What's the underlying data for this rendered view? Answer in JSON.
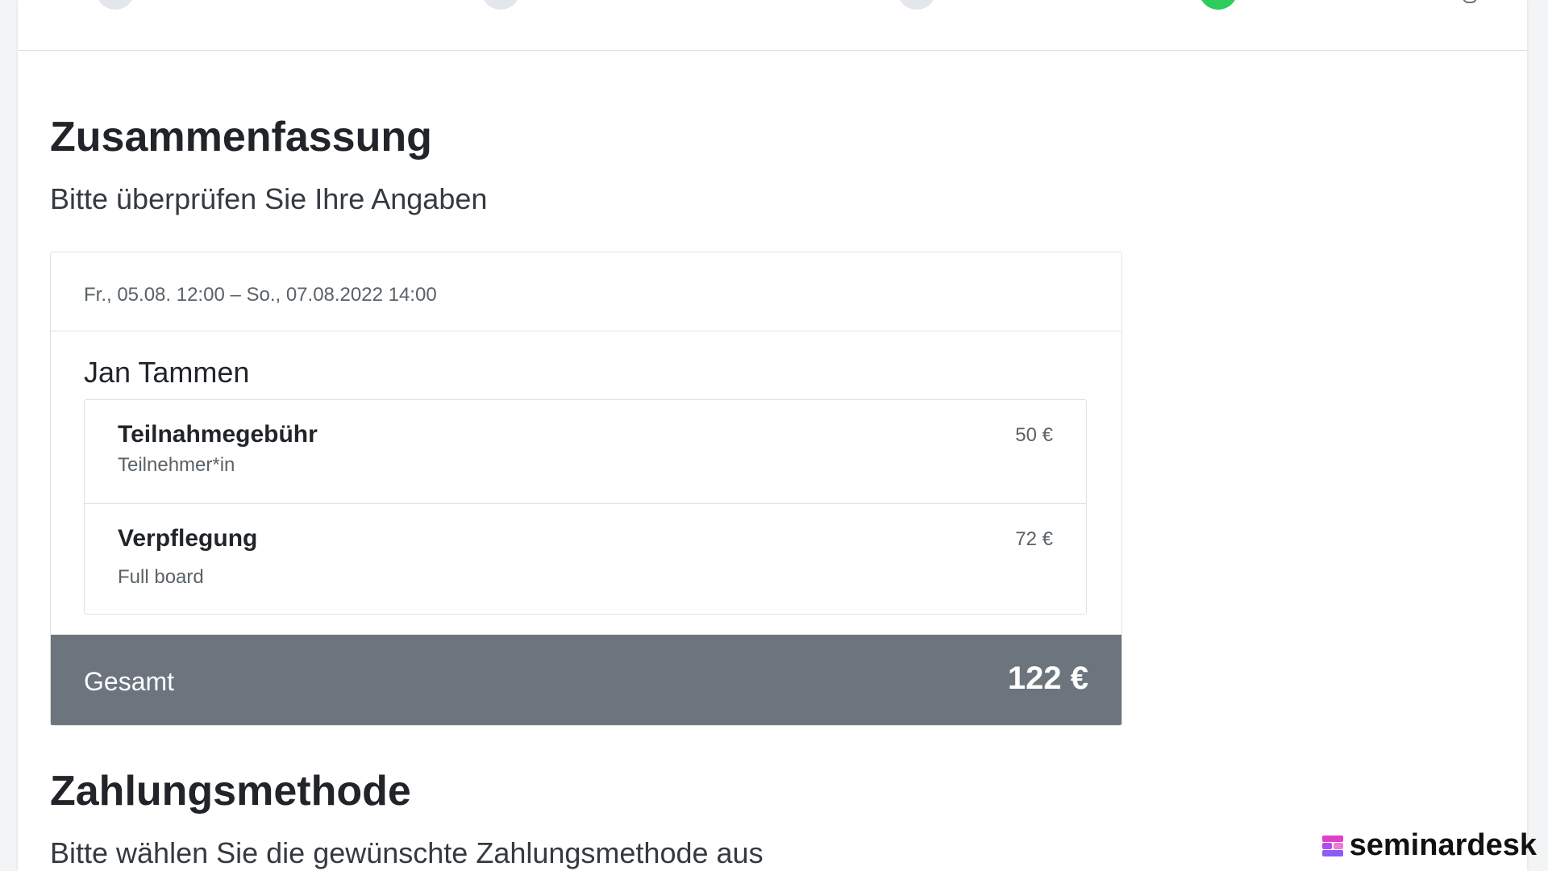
{
  "summary": {
    "title": "Zusammenfassung",
    "subtitle": "Bitte überprüfen Sie Ihre Angaben"
  },
  "booking": {
    "date_range": "Fr., 05.08. 12:00 – So., 07.08.2022 14:00",
    "participant_name": "Jan Tammen",
    "items": [
      {
        "name": "Teilnahmegebühr",
        "description": "Teilnehmer*in",
        "price": "50 €"
      },
      {
        "name": "Verpflegung",
        "description": "Full board",
        "price": "72 €"
      }
    ],
    "total_label": "Gesamt",
    "total_value": "122 €"
  },
  "payment": {
    "title": "Zahlungsmethode",
    "subtitle": "Bitte wählen Sie die gewünschte Zahlungsmethode aus"
  },
  "stepper": {
    "steps": [
      {
        "state": "inactive"
      },
      {
        "state": "inactive"
      },
      {
        "state": "inactive"
      },
      {
        "state": "active"
      }
    ]
  },
  "brand": {
    "name": "seminardesk",
    "logo_icon": "seminardesk-logo-icon"
  },
  "colors": {
    "active_step": "#2ecc5b",
    "inactive_step": "#e3e6ea",
    "total_bar": "#6c757d",
    "page_background": "#f3f4f6"
  }
}
